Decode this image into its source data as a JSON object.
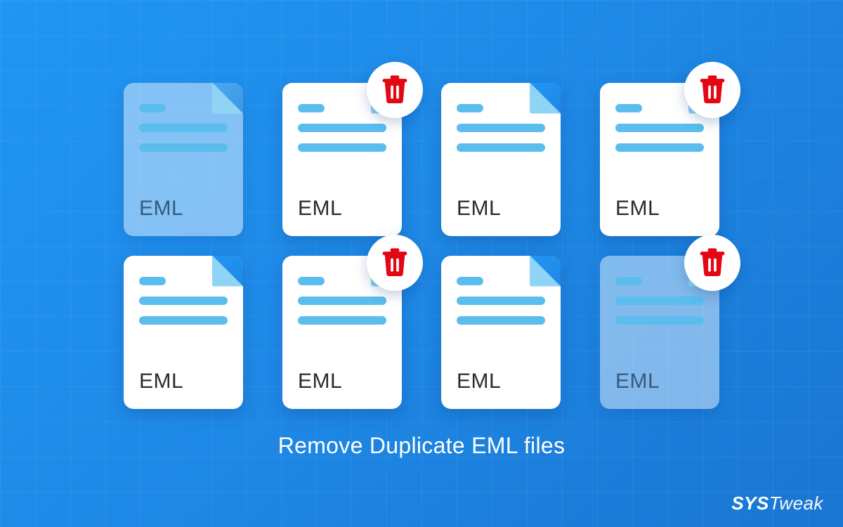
{
  "caption": "Remove Duplicate EML files",
  "brand": {
    "part1": "SYS",
    "part2": "Tweak"
  },
  "file_label": "EML",
  "icons": {
    "trash": "trash-icon"
  },
  "files": [
    {
      "id": "r1c1",
      "label": "EML",
      "translucent": true,
      "trash": false
    },
    {
      "id": "r1c2",
      "label": "EML",
      "translucent": false,
      "trash": true
    },
    {
      "id": "r1c3",
      "label": "EML",
      "translucent": false,
      "trash": false
    },
    {
      "id": "r1c4",
      "label": "EML",
      "translucent": false,
      "trash": true
    },
    {
      "id": "r2c1",
      "label": "EML",
      "translucent": false,
      "trash": false
    },
    {
      "id": "r2c2",
      "label": "EML",
      "translucent": false,
      "trash": true
    },
    {
      "id": "r2c3",
      "label": "EML",
      "translucent": false,
      "trash": false
    },
    {
      "id": "r2c4",
      "label": "EML",
      "translucent": true,
      "trash": true
    }
  ]
}
